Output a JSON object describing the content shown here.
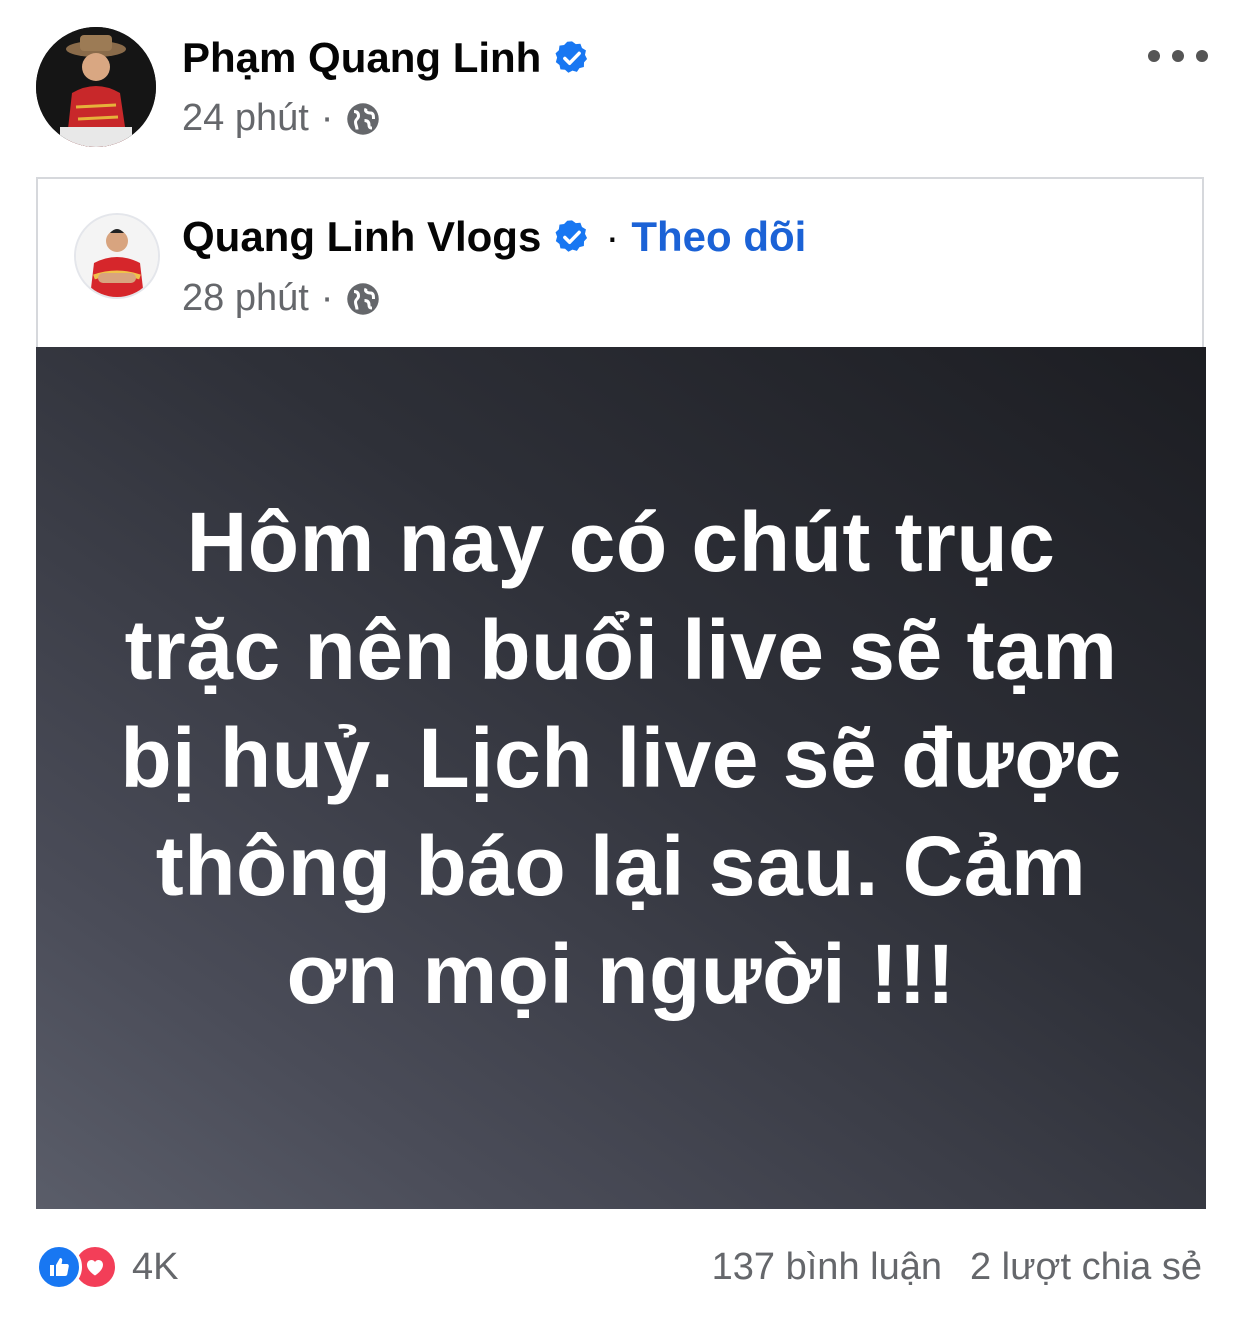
{
  "post": {
    "author": "Phạm Quang Linh",
    "time": "24 phút",
    "separator": "·"
  },
  "shared_post": {
    "author": "Quang Linh Vlogs",
    "follow_label": "Theo dõi",
    "separator": "·",
    "time": "28 phút",
    "text": "Hôm nay có chút trục trặc nên buổi live sẽ tạm bị huỷ. Lịch live sẽ được thông báo lại sau. Cảm ơn mọi người !!!"
  },
  "footer": {
    "reaction_count": "4K",
    "comments": "137 bình luận",
    "shares": "2 lượt chia sẻ"
  },
  "colors": {
    "link_blue": "#1b62d6",
    "verified_blue": "#1877f2",
    "meta_gray": "#65676b",
    "like_blue": "#1877f2",
    "love_red": "#f33e58"
  },
  "icons": {
    "verified": "verified-badge-icon",
    "globe": "globe-icon",
    "more": "more-options-icon",
    "like": "like-reaction-icon",
    "love": "love-reaction-icon"
  }
}
